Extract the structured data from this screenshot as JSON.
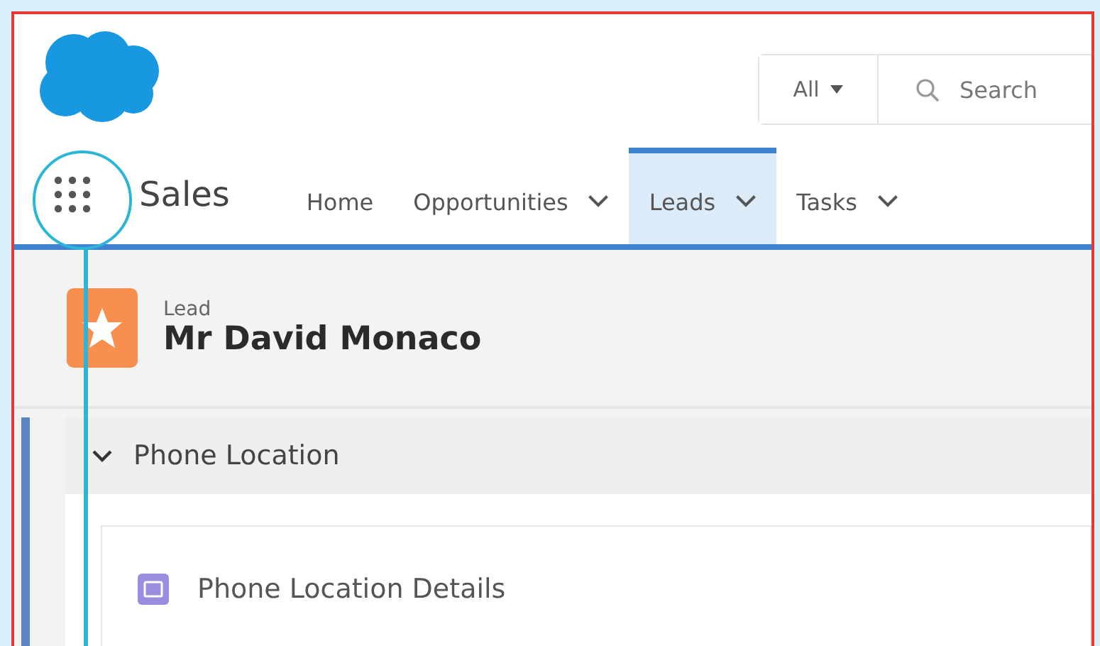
{
  "header": {
    "search_scope": "All",
    "search": {
      "placeholder": "Search"
    }
  },
  "nav": {
    "app_name": "Sales",
    "tabs": [
      {
        "label": "Home",
        "has_menu": false,
        "selected": false
      },
      {
        "label": "Opportunities",
        "has_menu": true,
        "selected": false
      },
      {
        "label": "Leads",
        "has_menu": true,
        "selected": true
      },
      {
        "label": "Tasks",
        "has_menu": true,
        "selected": false
      }
    ]
  },
  "record": {
    "type": "Lead",
    "name": "Mr David Monaco"
  },
  "section": {
    "title": "Phone Location",
    "expanded": true,
    "card_title": "Phone Location Details"
  }
}
